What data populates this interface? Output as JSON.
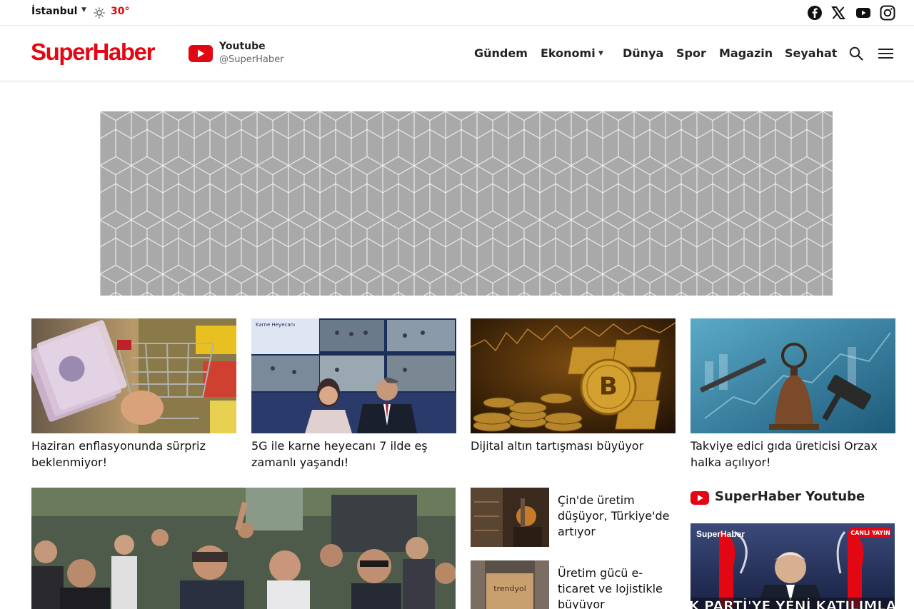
{
  "topbar": {
    "city": "İstanbul",
    "weather_icon": "sun-icon",
    "temperature": "30°",
    "social": [
      "facebook-icon",
      "x-icon",
      "youtube-icon",
      "instagram-icon"
    ]
  },
  "header": {
    "logo": "SuperHaber",
    "youtube_title": "Youtube",
    "youtube_handle": "@SuperHaber",
    "nav": [
      "Gündem",
      "Ekonomi",
      "Dünya",
      "Spor",
      "Magazin",
      "Seyahat"
    ]
  },
  "colors": {
    "brand_red": "#e30613",
    "ad_gray": "#a9a9a9"
  },
  "cards": [
    {
      "title": "Haziran enflasyonunda sürpriz beklenmiyor!"
    },
    {
      "title": "5G ile karne heyecanı 7 ilde eş zamanlı yaşandı!"
    },
    {
      "title": "Dijital altın tartışması büyüyor"
    },
    {
      "title": "Takviye edici gıda üreticisi Orzax halka açılıyor!"
    }
  ],
  "side_news": [
    {
      "title": "Çin'de üretim düşüyor, Türkiye'de artıyor"
    },
    {
      "title": "Üretim gücü e-ticaret ve lojistikle büyüyor"
    }
  ],
  "image_text": {
    "card2_banner": "Karne Heyecanı",
    "card3_symbol": "B",
    "side2_box": "trendyol"
  },
  "youtube_section": {
    "title": "SuperHaber Youtube",
    "thumb_logo": "SuperHaber",
    "thumb_badge": "CANLI YAYIN",
    "thumb_caption": "AK PARTİ'YE YENİ KATILIMLAR"
  }
}
